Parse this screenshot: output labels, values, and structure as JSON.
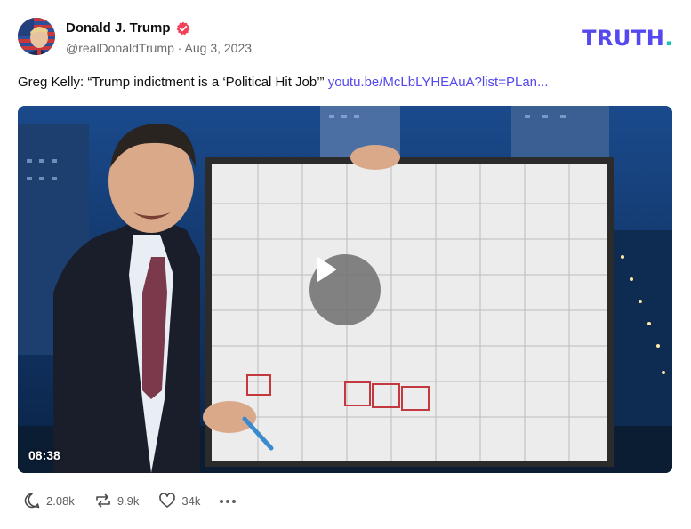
{
  "post": {
    "author": {
      "display_name": "Donald J. Trump",
      "handle": "@realDonaldTrump",
      "date": "Aug 3, 2023"
    },
    "meta_separator": " · ",
    "text": "Greg Kelly: “Trump indictment is a ‘Political Hit Job’” ",
    "link_text": "youtu.be/McLbLYHEAuA?list=PLan...",
    "video": {
      "duration": "08:38"
    },
    "stats": {
      "replies": "2.08k",
      "retruths": "9.9k",
      "likes": "34k"
    }
  },
  "brand": {
    "name": "TRUTH",
    "suffix": ".",
    "color": "#5448ee",
    "accent": "#18c5b0"
  },
  "icons": {
    "verified": "verified-badge-icon",
    "play": "play-icon",
    "reply": "reply-bubble-icon",
    "retruth": "retruth-arrows-icon",
    "like": "heart-icon",
    "more": "more-dots-icon"
  },
  "colors": {
    "link": "#5448ee",
    "verified": "#f0435a",
    "muted": "#6b6b6b"
  }
}
